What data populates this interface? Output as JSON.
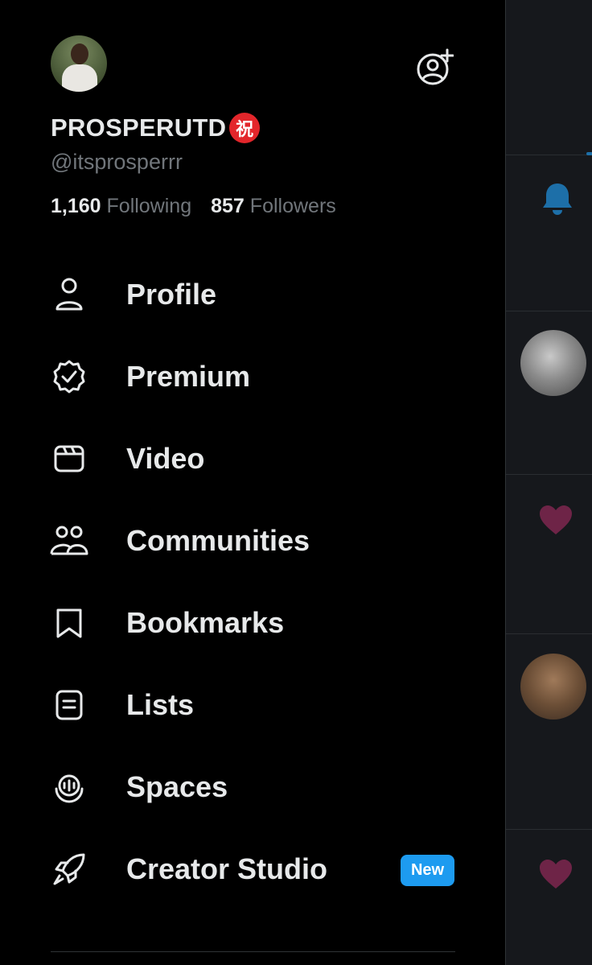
{
  "profile": {
    "display_name": "PROSPERUTD",
    "emoji_badge": "祝",
    "handle": "@itsprosperrr",
    "following_count": "1,160",
    "following_label": "Following",
    "followers_count": "857",
    "followers_label": "Followers"
  },
  "menu": {
    "items": [
      {
        "label": "Profile",
        "icon": "person-icon"
      },
      {
        "label": "Premium",
        "icon": "verified-badge-icon"
      },
      {
        "label": "Video",
        "icon": "video-clapper-icon"
      },
      {
        "label": "Communities",
        "icon": "communities-icon"
      },
      {
        "label": "Bookmarks",
        "icon": "bookmark-icon"
      },
      {
        "label": "Lists",
        "icon": "list-icon"
      },
      {
        "label": "Spaces",
        "icon": "spaces-icon"
      },
      {
        "label": "Creator Studio",
        "icon": "rocket-icon",
        "badge": "New"
      }
    ]
  },
  "colors": {
    "background": "#000000",
    "text_primary": "#e7e9ea",
    "text_secondary": "#71767b",
    "accent_blue": "#1d9bf0",
    "heart_muted": "#6e2447",
    "bell_muted": "#1d6fa8"
  }
}
